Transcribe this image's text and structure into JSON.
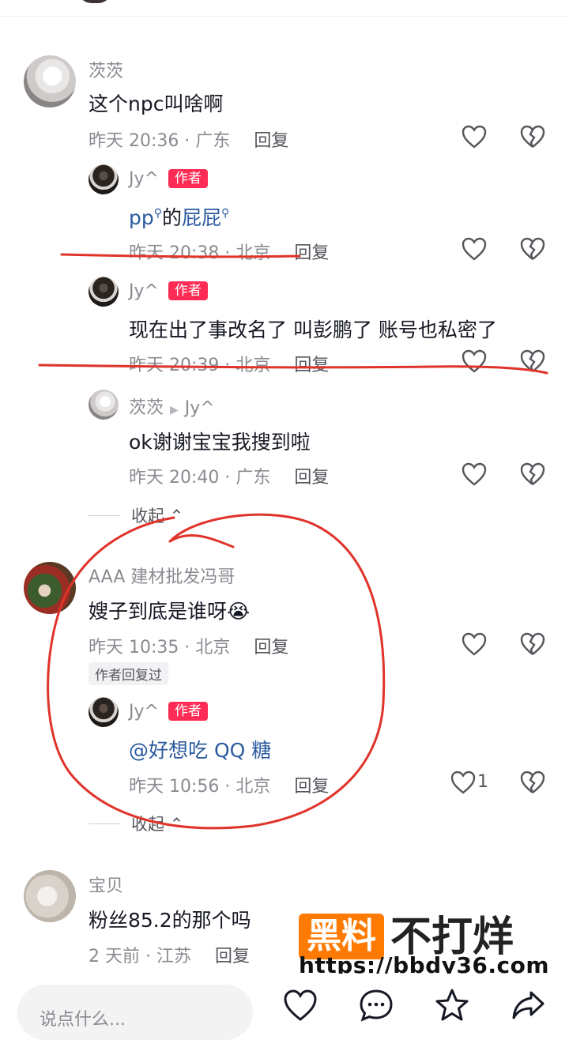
{
  "comments": {
    "c1": {
      "user": "茨茨",
      "text": "这个npc叫啥啊",
      "time": "昨天 20:36 · 广东",
      "reply": "回复",
      "replies": {
        "r1": {
          "user": "Jy^",
          "tag": "作者",
          "text_a": "pp",
          "text_b": "的",
          "text_c": "屁屁",
          "time": "昨天 20:38 · 北京",
          "reply": "回复"
        },
        "r2": {
          "user": "Jy^",
          "tag": "作者",
          "text": "现在出了事改名了 叫彭鹏了 账号也私密了",
          "time": "昨天 20:39 · 北京",
          "reply": "回复"
        },
        "r3": {
          "user": "茨茨",
          "reply_to": "Jy^",
          "text": "ok谢谢宝宝我搜到啦",
          "time": "昨天 20:40 · 广东",
          "reply": "回复"
        }
      },
      "collapse": "收起"
    },
    "c2": {
      "user": "AAA 建材批发冯哥",
      "text": "嫂子到底是谁呀😭",
      "time": "昨天 10:35 · 北京",
      "reply": "回复",
      "author_replied": "作者回复过",
      "replies": {
        "r1": {
          "user": "Jy^",
          "tag": "作者",
          "text": "@好想吃 QQ 糖",
          "time": "昨天 10:56 · 北京",
          "reply": "回复",
          "likes": "1"
        }
      },
      "collapse": "收起"
    },
    "c3": {
      "user": "宝贝",
      "text": "粉丝85.2的那个吗",
      "time": "2 天前 · 江苏",
      "reply": "回复"
    }
  },
  "watermark": {
    "box": "黑料",
    "big": "不打烊",
    "url": "https://bbdy36.com"
  },
  "bottom": {
    "placeholder": "说点什么..."
  },
  "colors": {
    "author_tag": "#fe2c55",
    "link": "#2b5a9e",
    "annotation": "#e0332a",
    "watermark": "#fe7a00"
  }
}
